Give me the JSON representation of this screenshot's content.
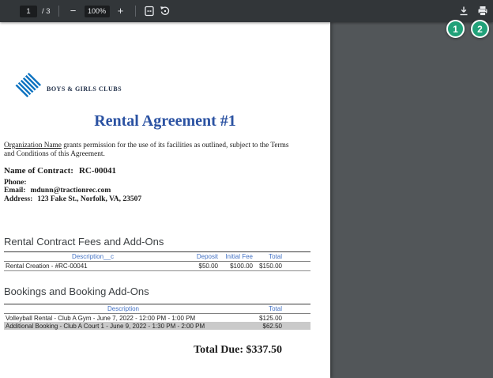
{
  "toolbar": {
    "page_current": "1",
    "page_total": "/ 3",
    "zoom_level": "100%",
    "minus_label": "−",
    "plus_label": "+"
  },
  "annotations": {
    "step1": "1",
    "step2": "2",
    "circle_color": "#21a179"
  },
  "document": {
    "logo_text": "BOYS & GIRLS CLUBS",
    "title": "Rental Agreement #1",
    "intro_org": "Organization Name",
    "intro_line1_rest": " grants permission for the use of its facilities as outlined, subject to the Terms",
    "intro_line2": "and Conditions of this Agreement.",
    "contract_label": "Name of Contract:",
    "contract_value": "RC-00041",
    "phone_label": "Phone:",
    "phone_value": "",
    "email_label": "Email:",
    "email_value": "mdunn@tractionrec.com",
    "address_label": "Address:",
    "address_value": "123 Fake St., Norfolk, VA, 23507",
    "section1": {
      "heading": "Rental Contract Fees and Add-Ons",
      "headers": [
        "Description__c",
        "Deposit",
        "Initial Fee",
        "Total"
      ],
      "rows": [
        {
          "description": "Rental Creation - #RC-00041",
          "deposit": "$50.00",
          "initial_fee": "$100.00",
          "total": "$150.00"
        }
      ]
    },
    "section2": {
      "heading": "Bookings and Booking Add-Ons",
      "headers": [
        "Description",
        "Total"
      ],
      "rows": [
        {
          "description": "Volleyball Rental - Club A Gym - June 7, 2022 - 12:00 PM - 1:00 PM",
          "total": "$125.00"
        },
        {
          "description": "Additional Booking - Club A Court 1 - June 9, 2022 - 1:30 PM - 2:00 PM",
          "total": "$62.50"
        }
      ]
    },
    "total_due": "Total Due: $337.50"
  },
  "colors": {
    "toolbar_bg": "#323639",
    "viewer_bg": "#525659",
    "title_blue": "#2b52a2",
    "table_header_blue": "#4472c4",
    "logo_blue": "#0d72c0",
    "shaded_row": "#cacaca",
    "annotation_green": "#21a179"
  }
}
